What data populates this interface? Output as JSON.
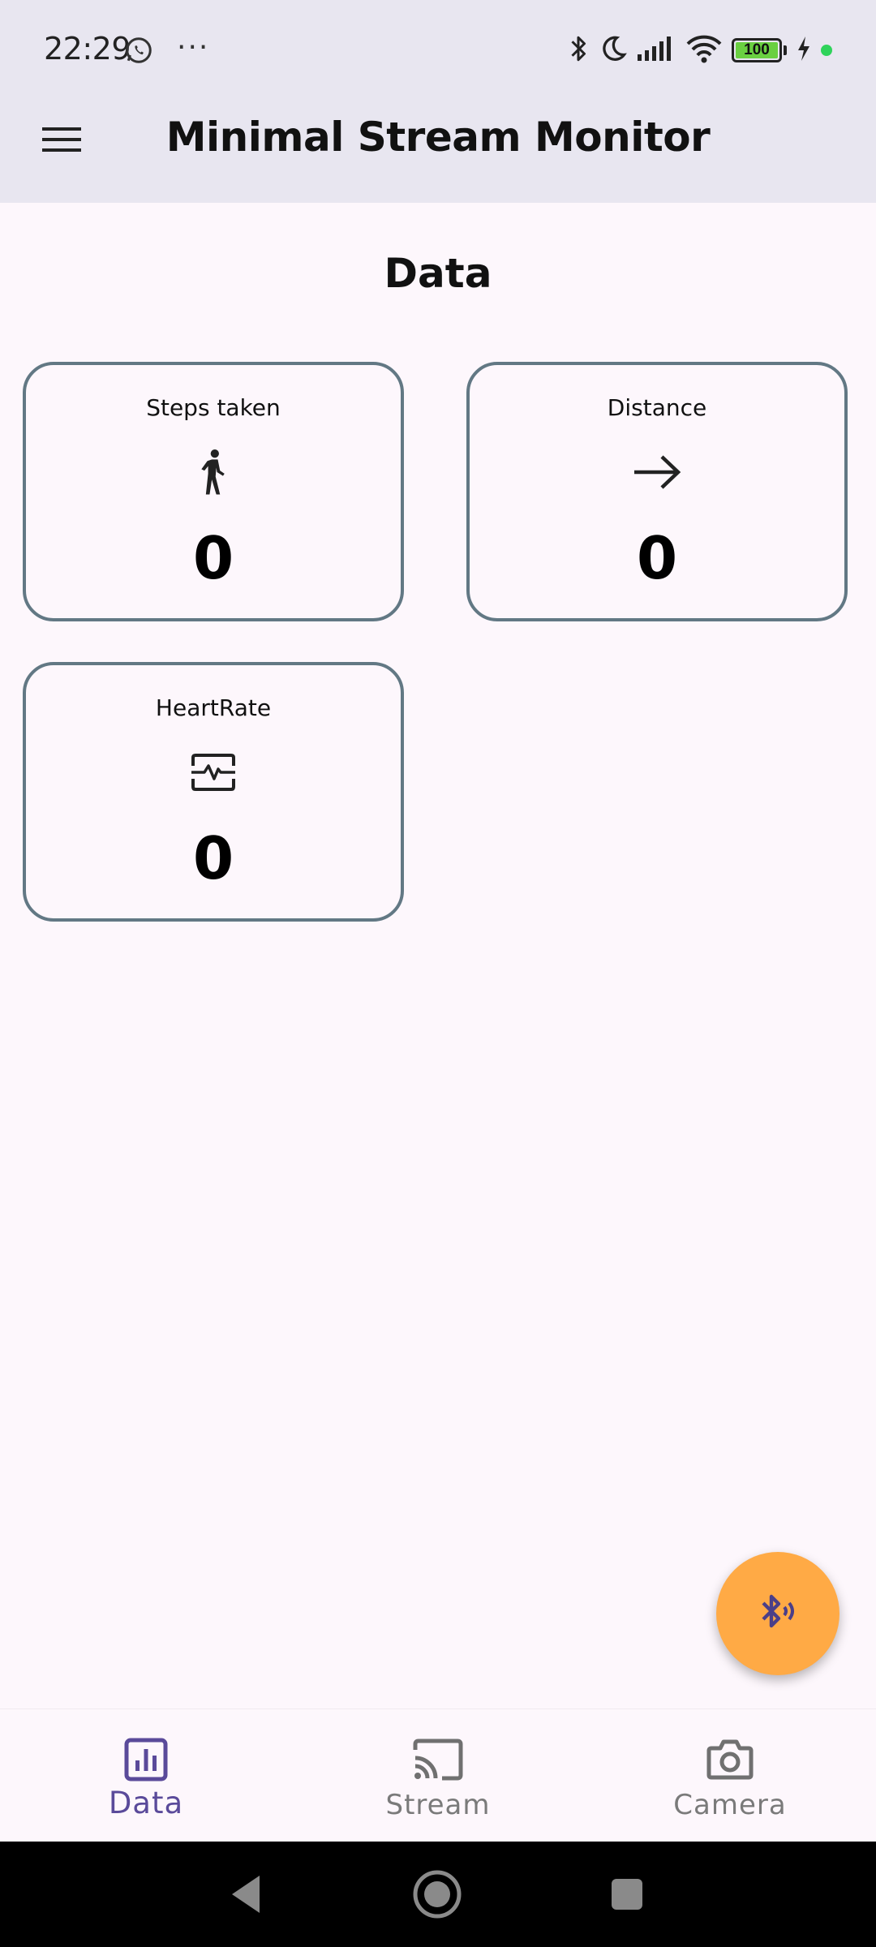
{
  "status_bar": {
    "time": "22:29",
    "overflow_dots": "···",
    "battery_level": "100",
    "icons": [
      "whatsapp-icon",
      "bluetooth-icon",
      "moon-icon",
      "signal-icon",
      "wifi-icon",
      "battery-icon",
      "charging-icon",
      "dot-icon"
    ]
  },
  "app_bar": {
    "title": "Minimal Stream Monitor",
    "menu_icon": "hamburger-menu-icon"
  },
  "page": {
    "section_title": "Data"
  },
  "cards": [
    {
      "label": "Steps taken",
      "icon": "walking-icon",
      "value": "0"
    },
    {
      "label": "Distance",
      "icon": "arrow-right-icon",
      "value": "0"
    },
    {
      "label": "HeartRate",
      "icon": "heartbeat-monitor-icon",
      "value": "0"
    }
  ],
  "fab": {
    "icon": "bluetooth-searching-icon"
  },
  "bottom_nav": {
    "items": [
      {
        "label": "Data",
        "icon": "bar-chart-icon",
        "active": true
      },
      {
        "label": "Stream",
        "icon": "cast-icon",
        "active": false
      },
      {
        "label": "Camera",
        "icon": "camera-icon",
        "active": false
      }
    ]
  },
  "colors": {
    "app_bar_bg": "#e8e6f0",
    "page_bg": "#fdf7fc",
    "card_border": "#627884",
    "fab_bg": "#ffaa45",
    "accent": "#5a4a9a",
    "battery_green": "#6ad041"
  }
}
